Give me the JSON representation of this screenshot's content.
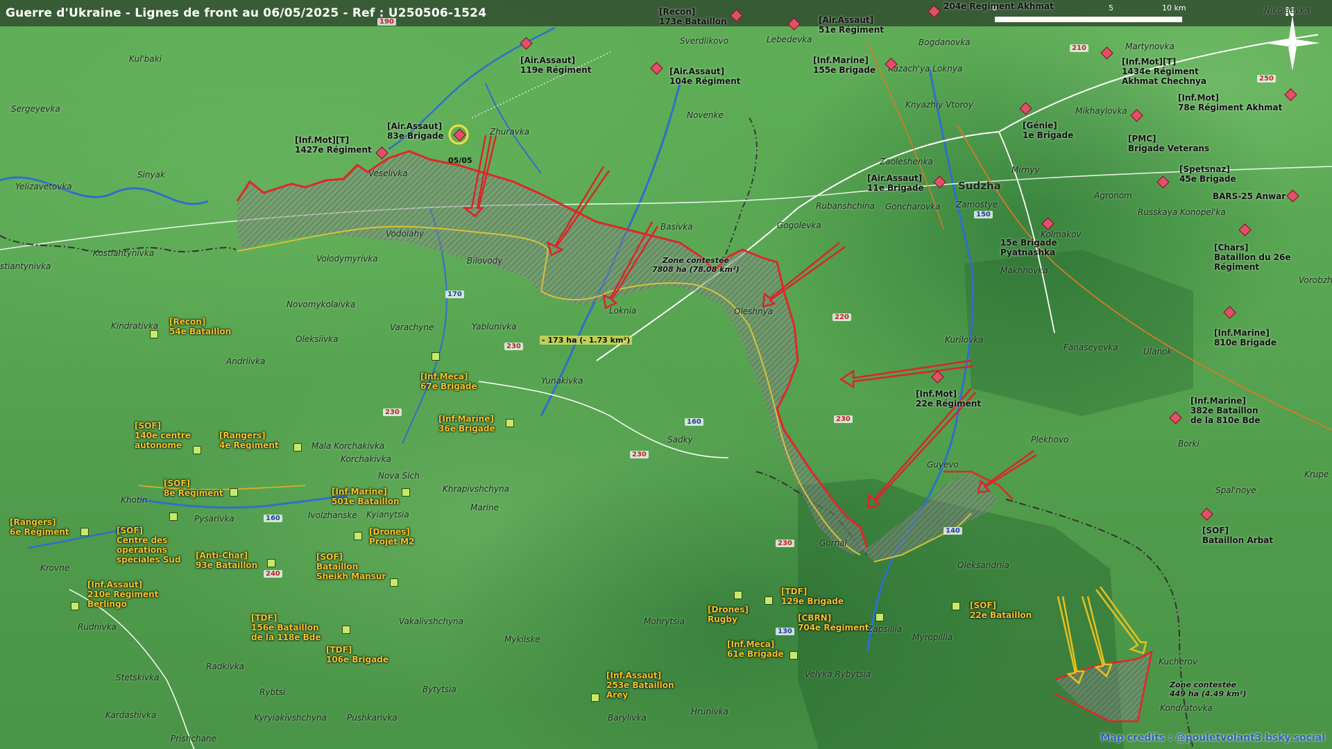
{
  "title": "Guerre d'Ukraine - Lignes de front au 06/05/2025 - Ref : U250506-1524",
  "scale": {
    "zero": "0",
    "mid": "5",
    "end": "10 km"
  },
  "north": "N",
  "credits": "Map credits : @pouletvolant3.bsky.social",
  "towns": [
    {
      "name": "Kul'baki"
    },
    {
      "name": "Sergeyevka"
    },
    {
      "name": "Sinyak"
    },
    {
      "name": "Yelizavetovka"
    },
    {
      "name": "Kostiantynivka"
    },
    {
      "name": "stiantynivka"
    },
    {
      "name": "Volodymyrivka"
    },
    {
      "name": "Novomykolaivka"
    },
    {
      "name": "Kindrativka"
    },
    {
      "name": "Oleksiivka"
    },
    {
      "name": "Andriivka"
    },
    {
      "name": "Varachyne"
    },
    {
      "name": "Yablunivka"
    },
    {
      "name": "Bilovody"
    },
    {
      "name": "Vodolahy"
    },
    {
      "name": "Veselivka"
    },
    {
      "name": "Zhuravka"
    },
    {
      "name": "Sverdlikovo"
    },
    {
      "name": "Lebedevka"
    },
    {
      "name": "Bogdanovka"
    },
    {
      "name": "Novenke"
    },
    {
      "name": "Basivka"
    },
    {
      "name": "Loknia"
    },
    {
      "name": "Oleshnya"
    },
    {
      "name": "Yunakivka"
    },
    {
      "name": "Sadky"
    },
    {
      "name": "Gogolevka"
    },
    {
      "name": "Rubanshchina"
    },
    {
      "name": "Zaoleshenka"
    },
    {
      "name": "Goncharovka"
    },
    {
      "name": "Sudzha"
    },
    {
      "name": "Zamostye"
    },
    {
      "name": "Mirnyy"
    },
    {
      "name": "Agronom"
    },
    {
      "name": "Kolmakov"
    },
    {
      "name": "Makhnovka"
    },
    {
      "name": "Kurilovka"
    },
    {
      "name": "Fanaseyevka"
    },
    {
      "name": "Ulanok"
    },
    {
      "name": "Plekhovo"
    },
    {
      "name": "Guyevo"
    },
    {
      "name": "Gornal"
    },
    {
      "name": "Oleksandriia"
    },
    {
      "name": "Myropillia"
    },
    {
      "name": "Zapsillia"
    },
    {
      "name": "Velyka Rybytsia"
    },
    {
      "name": "Mohrytsia"
    },
    {
      "name": "Mala Korchakivka"
    },
    {
      "name": "Korchakivka"
    },
    {
      "name": "Nova Sich"
    },
    {
      "name": "Khrapivshchyna"
    },
    {
      "name": "Marine"
    },
    {
      "name": "Khotin"
    },
    {
      "name": "Pysarivka"
    },
    {
      "name": "Ivolzhanske"
    },
    {
      "name": "Kyianytsia"
    },
    {
      "name": "Krovne"
    },
    {
      "name": "Rudnivka"
    },
    {
      "name": "Vakalivshchyna"
    },
    {
      "name": "Mykilske"
    },
    {
      "name": "Radkivka"
    },
    {
      "name": "Stetskivka"
    },
    {
      "name": "Kardashivka"
    },
    {
      "name": "Rybtsi"
    },
    {
      "name": "Kyryiakivshchyna"
    },
    {
      "name": "Pushkarivka"
    },
    {
      "name": "Bytytsia"
    },
    {
      "name": "Barylivka"
    },
    {
      "name": "Hrunivka"
    },
    {
      "name": "Prishchane"
    },
    {
      "name": "Kucherov"
    },
    {
      "name": "Kondratovka"
    },
    {
      "name": "Borki"
    },
    {
      "name": "Spal'noye"
    },
    {
      "name": "Krupe"
    },
    {
      "name": "Vorobzh"
    },
    {
      "name": "Russkaya Konopel'ka"
    },
    {
      "name": "Martynovka"
    },
    {
      "name": "Mikhaylovka"
    },
    {
      "name": "Kazach'ya Loknya"
    },
    {
      "name": "Knyazhiy Vtoroy"
    },
    {
      "name": "Nikolaevka"
    }
  ],
  "roads": [
    {
      "label": "190",
      "kind": "red"
    },
    {
      "label": "210",
      "kind": "red"
    },
    {
      "label": "250",
      "kind": "red"
    },
    {
      "label": "150",
      "kind": "blue"
    },
    {
      "label": "170",
      "kind": "blue"
    },
    {
      "label": "220",
      "kind": "red"
    },
    {
      "label": "230",
      "kind": "red"
    },
    {
      "label": "230",
      "kind": "red"
    },
    {
      "label": "230",
      "kind": "red"
    },
    {
      "label": "230",
      "kind": "red"
    },
    {
      "label": "230",
      "kind": "red"
    },
    {
      "label": "160",
      "kind": "blue"
    },
    {
      "label": "160",
      "kind": "blue"
    },
    {
      "label": "240",
      "kind": "red"
    },
    {
      "label": "140",
      "kind": "blue"
    },
    {
      "label": "130",
      "kind": "blue"
    }
  ],
  "russian_units": [
    {
      "line1": "[Recon]",
      "line2": "173e Bataillon"
    },
    {
      "line1": "204e Régiment Akhmat",
      "line2": ""
    },
    {
      "line1": "[Air.Assaut]",
      "line2": "51e Régiment"
    },
    {
      "line1": "[Air.Assaut]",
      "line2": "119e Régiment"
    },
    {
      "line1": "[Air.Assaut]",
      "line2": "104e Régiment"
    },
    {
      "line1": "[Inf.Marine]",
      "line2": "155e Brigade"
    },
    {
      "line1": "[Air.Assaut]",
      "line2": "83e Brigade"
    },
    {
      "line1": "[Inf.Mot][T]",
      "line2": "1427e Régiment"
    },
    {
      "line1": "[Inf.Mot][T]",
      "line2": "1434e Régiment",
      "line3": "Akhmat Chechnya"
    },
    {
      "line1": "[Inf.Mot]",
      "line2": "78e Régiment Akhmat"
    },
    {
      "line1": "[Génie]",
      "line2": "1e Brigade"
    },
    {
      "line1": "[PMC]",
      "line2": "Brigade Veterans"
    },
    {
      "line1": "[Spetsnaz]",
      "line2": "45e Brigade"
    },
    {
      "line1": "[Air.Assaut]",
      "line2": "11e Brigade"
    },
    {
      "line1": "BARS-25 Anwar",
      "line2": ""
    },
    {
      "line1": "15e Brigade",
      "line2": "Pyatnashka"
    },
    {
      "line1": "[Chars]",
      "line2": "Bataillon du 26e",
      "line3": "Régiment"
    },
    {
      "line1": "[Inf.Marine]",
      "line2": "810e Brigade"
    },
    {
      "line1": "[Inf.Mot]",
      "line2": "22e Régiment"
    },
    {
      "line1": "[Inf.Marine]",
      "line2": "382e Bataillon",
      "line3": "de la 810e Bde"
    },
    {
      "line1": "[SOF]",
      "line2": "Bataillon Arbat"
    }
  ],
  "ukrainian_units": [
    {
      "line1": "[Recon]",
      "line2": "54e Bataillon"
    },
    {
      "line1": "[Inf.Meca]",
      "line2": "67e Brigade"
    },
    {
      "line1": "[Inf.Marine]",
      "line2": "36e Brigade"
    },
    {
      "line1": "[SOF]",
      "line2": "140e centre",
      "line3": "autonome"
    },
    {
      "line1": "[Rangers]",
      "line2": "4e Régiment"
    },
    {
      "line1": "[SOF]",
      "line2": "8e Régiment"
    },
    {
      "line1": "[Inf.Marine]",
      "line2": "501e Bataillon"
    },
    {
      "line1": "[Rangers]",
      "line2": "6e Régiment"
    },
    {
      "line1": "[SOF]",
      "line2": "Centre des",
      "line3": "opérations",
      "line4": "spéciales Sud"
    },
    {
      "line1": "[Drones]",
      "line2": "Projet M2"
    },
    {
      "line1": "[Anti-Char]",
      "line2": "93e Bataillon"
    },
    {
      "line1": "[SOF]",
      "line2": "Bataillon",
      "line3": "Sheikh Mansur"
    },
    {
      "line1": "[Inf.Assaut]",
      "line2": "210e Régiment",
      "line3": "Berlingo"
    },
    {
      "line1": "[TDF]",
      "line2": "156e Bataillon",
      "line3": "de la 118e Bde"
    },
    {
      "line1": "[TDF]",
      "line2": "106e Brigade"
    },
    {
      "line1": "[Drones]",
      "line2": "Rugby"
    },
    {
      "line1": "[TDF]",
      "line2": "129e Brigade"
    },
    {
      "line1": "[CBRN]",
      "line2": "704e Régiment"
    },
    {
      "line1": "[Inf.Meca]",
      "line2": "61e Brigade"
    },
    {
      "line1": "[Inf.Assaut]",
      "line2": "253e Bataillon",
      "line3": "Arey"
    },
    {
      "line1": "[SOF]",
      "line2": "22e Bataillon"
    }
  ],
  "zones": {
    "main": {
      "line1": "Zone contestée",
      "line2": "7808 ha (78.08 km²)"
    },
    "south": {
      "line1": "Zone contestée",
      "line2": "449 ha (4.49 km²)"
    },
    "loss": "- 173 ha (- 1.73 km²)"
  },
  "date_marker": "05/05",
  "colors": {
    "front_line": "#e0262a",
    "ua_line": "#d9c23a",
    "arrow_ru": "#d8262a",
    "arrow_ua": "#e8c020",
    "ru_marker": "#e0506a",
    "ua_marker": "#c8e86a"
  }
}
